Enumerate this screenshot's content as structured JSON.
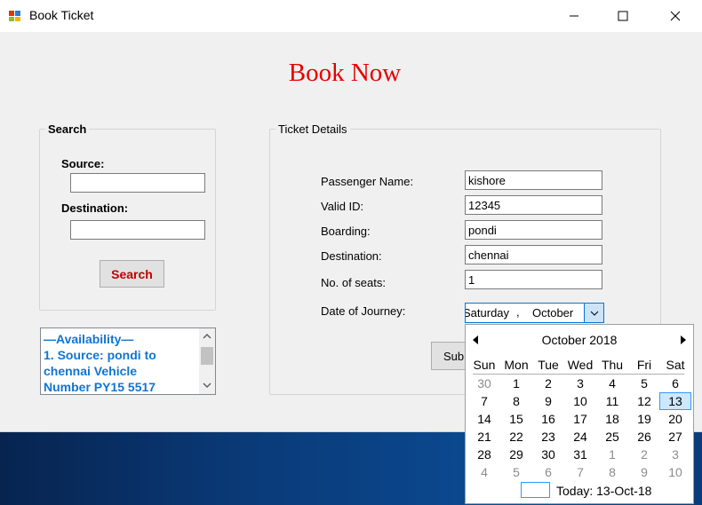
{
  "window": {
    "title": "Book Ticket"
  },
  "heading": "Book Now",
  "search_group": {
    "legend": "Search",
    "source_label": "Source:",
    "source_value": "",
    "destination_label": "Destination:",
    "destination_value": "",
    "search_button": "Search"
  },
  "availability": {
    "line1": "—Availability—",
    "line2": "1. Source: pondi to",
    "line3": "chennai Vehicle",
    "line4": "Number PY15 5517"
  },
  "ticket_group": {
    "legend": "Ticket Details",
    "fields": [
      {
        "label": "Passenger Name:",
        "value": "kishore"
      },
      {
        "label": "Valid ID:",
        "value": "12345"
      },
      {
        "label": "Boarding:",
        "value": "pondi"
      },
      {
        "label": "Destination:",
        "value": "chennai"
      },
      {
        "label": "No. of seats:",
        "value": "1"
      }
    ],
    "date_label": "Date of Journey:",
    "date_day": "Saturday",
    "date_sep": ",",
    "date_month": "October",
    "submit_partial": "Sub"
  },
  "calendar": {
    "month_title": "October 2018",
    "weekdays": [
      "Sun",
      "Mon",
      "Tue",
      "Wed",
      "Thu",
      "Fri",
      "Sat"
    ],
    "weeks": [
      [
        "30",
        "1",
        "2",
        "3",
        "4",
        "5",
        "6"
      ],
      [
        "7",
        "8",
        "9",
        "10",
        "11",
        "12",
        "13"
      ],
      [
        "14",
        "15",
        "16",
        "17",
        "18",
        "19",
        "20"
      ],
      [
        "21",
        "22",
        "23",
        "24",
        "25",
        "26",
        "27"
      ],
      [
        "28",
        "29",
        "30",
        "31",
        "1",
        "2",
        "3"
      ],
      [
        "4",
        "5",
        "6",
        "7",
        "8",
        "9",
        "10"
      ]
    ],
    "selected_day": "13",
    "today_text": "Today: 13-Oct-18"
  },
  "colors": {
    "heading": "#e60000",
    "search_button_text": "#c00000",
    "availability_text": "#1174d4",
    "calendar_selected_border": "#3399ff",
    "calendar_other_month": "#8c8c8c"
  }
}
